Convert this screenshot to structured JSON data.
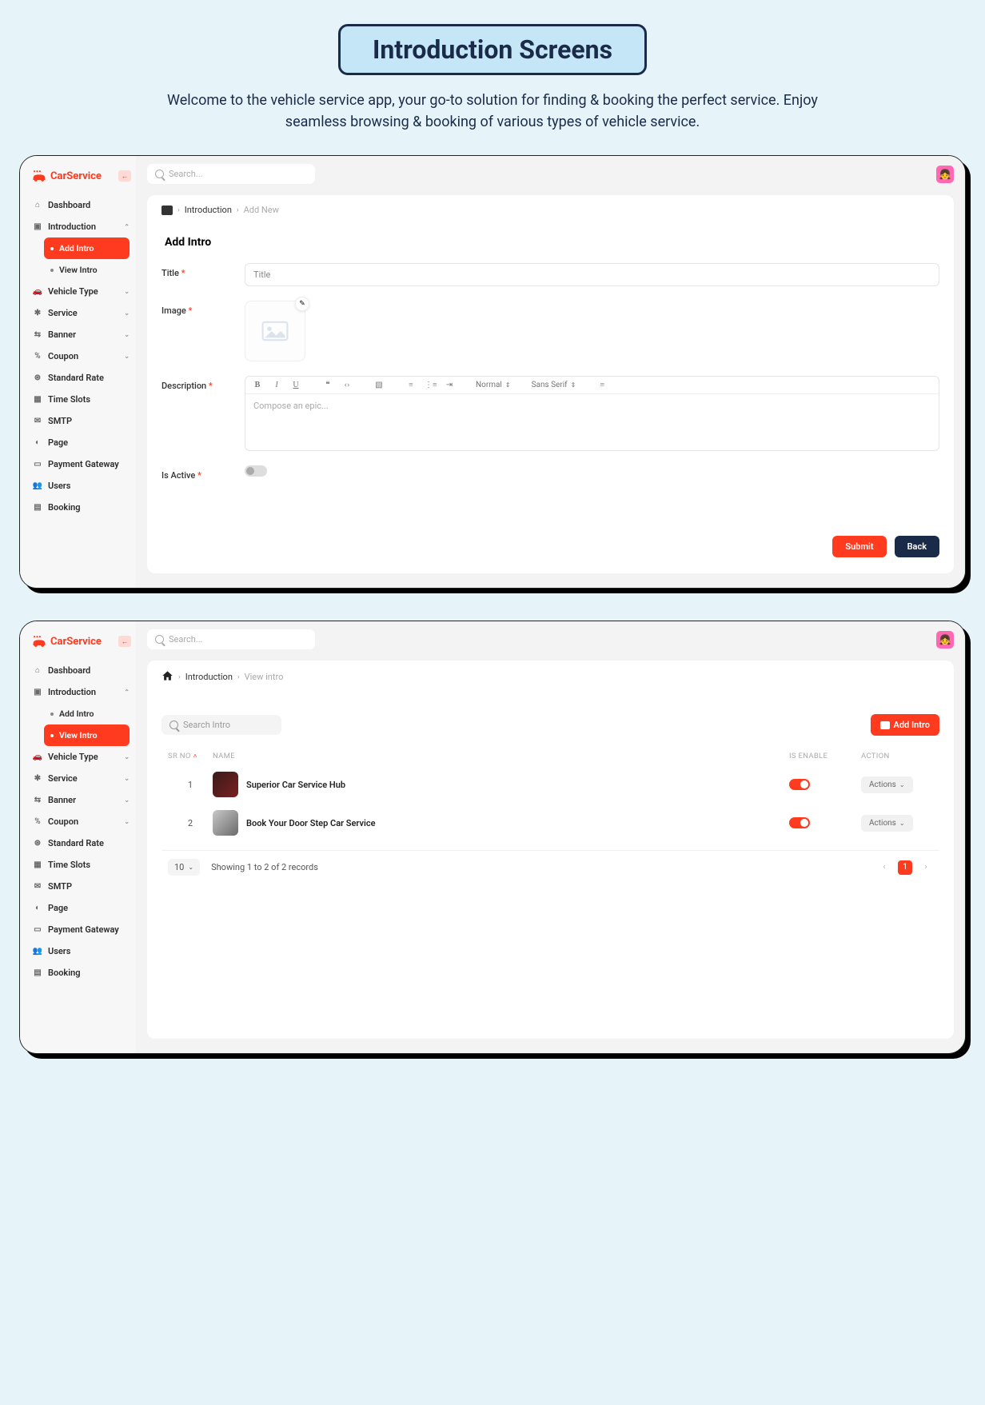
{
  "page": {
    "title": "Introduction Screens",
    "subtitle": "Welcome to the vehicle service app, your go-to solution for finding & booking the perfect service. Enjoy seamless browsing & booking of various types of vehicle service."
  },
  "brand": {
    "name": "CarService"
  },
  "search": {
    "placeholder": "Search..."
  },
  "sidebar": {
    "items": [
      {
        "label": "Dashboard",
        "icon": "home"
      },
      {
        "label": "Introduction",
        "icon": "intro",
        "expanded": true,
        "children": [
          {
            "label": "Add Intro"
          },
          {
            "label": "View Intro"
          }
        ]
      },
      {
        "label": "Vehicle Type",
        "icon": "car",
        "chev": true
      },
      {
        "label": "Service",
        "icon": "gear",
        "chev": true
      },
      {
        "label": "Banner",
        "icon": "banner",
        "chev": true
      },
      {
        "label": "Coupon",
        "icon": "coupon",
        "chev": true
      },
      {
        "label": "Standard Rate",
        "icon": "rate",
        "chev": true
      },
      {
        "label": "Time Slots",
        "icon": "clock"
      },
      {
        "label": "SMTP",
        "icon": "mail"
      },
      {
        "label": "Page",
        "icon": "page"
      },
      {
        "label": "Payment Gateway",
        "icon": "payment"
      },
      {
        "label": "Users",
        "icon": "users"
      },
      {
        "label": "Booking",
        "icon": "booking"
      }
    ]
  },
  "screen1": {
    "breadcrumb": {
      "root": "Introduction",
      "leaf": "Add New"
    },
    "form": {
      "heading": "Add Intro",
      "title_label": "Title",
      "title_placeholder": "Title",
      "image_label": "Image",
      "description_label": "Description",
      "rte_placeholder": "Compose an epic...",
      "rte_normal": "Normal",
      "rte_font": "Sans Serif",
      "is_active_label": "Is Active",
      "submit": "Submit",
      "back": "Back"
    }
  },
  "screen2": {
    "breadcrumb": {
      "root": "Introduction",
      "leaf": "View intro"
    },
    "list": {
      "search_placeholder": "Search Intro",
      "add_label": "Add Intro",
      "cols": {
        "sr": "SR NO",
        "name": "NAME",
        "enable": "IS ENABLE",
        "action": "ACTION"
      },
      "rows": [
        {
          "sr": "1",
          "name": "Superior Car Service Hub",
          "enabled": true
        },
        {
          "sr": "2",
          "name": "Book Your Door Step Car Service",
          "enabled": true
        }
      ],
      "action_label": "Actions",
      "per_page": "10",
      "records_text": "Showing 1 to 2 of 2 records",
      "page": "1"
    }
  }
}
